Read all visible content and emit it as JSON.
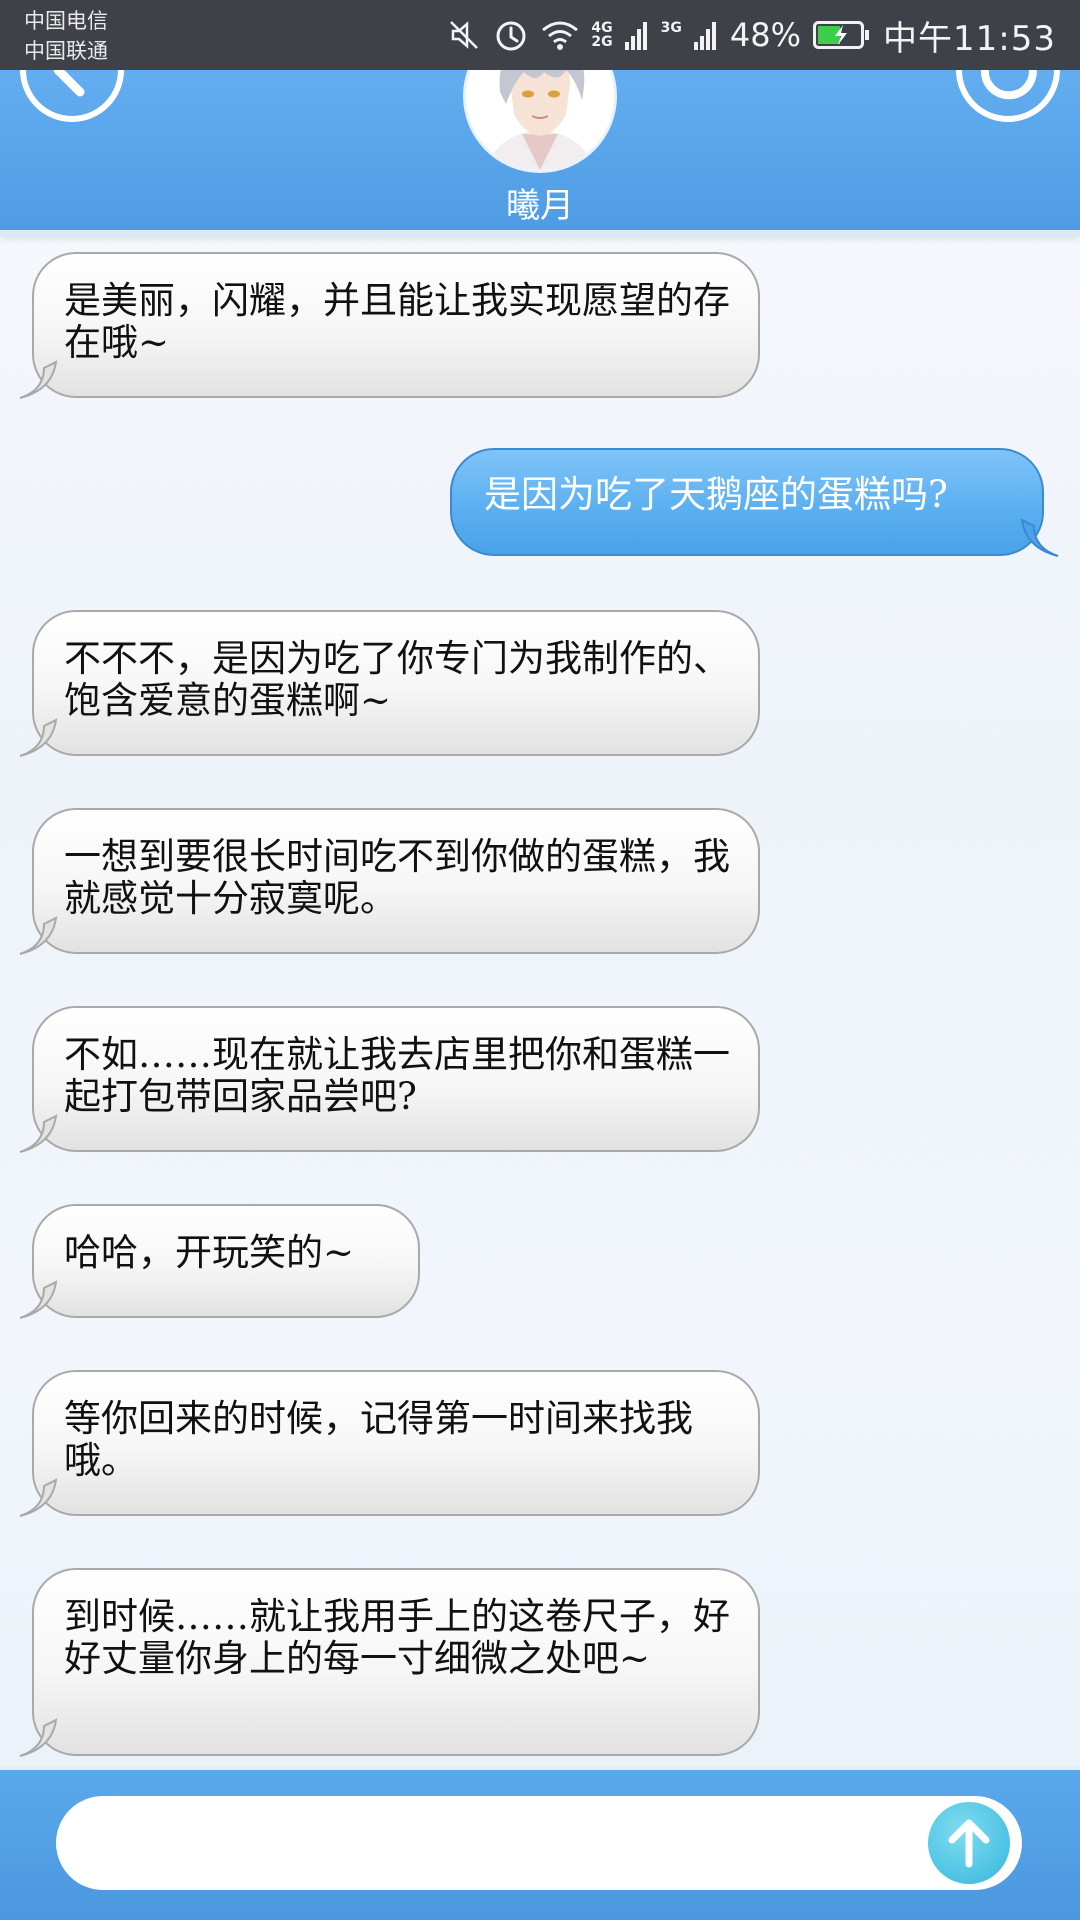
{
  "status_bar": {
    "carrier_1": "中国电信",
    "carrier_2": "中国联通",
    "net_1_top": "4G",
    "net_1_bottom": "2G",
    "net_2": "3G",
    "battery": "48%",
    "time": "中午11:53",
    "icons": [
      "mute-icon",
      "alarm-icon",
      "wifi-icon",
      "signal-icon",
      "battery-charging-icon"
    ]
  },
  "header": {
    "contact_name": "曦月",
    "back_icon": "chevron-left-icon",
    "refresh_icon": "refresh-icon"
  },
  "messages": [
    {
      "side": "left",
      "text": "是美丽，闪耀，并且能让我实现愿望的存在哦~"
    },
    {
      "side": "right",
      "text": "是因为吃了天鹅座的蛋糕吗?"
    },
    {
      "side": "left",
      "text": "不不不，是因为吃了你专门为我制作的、饱含爱意的蛋糕啊~"
    },
    {
      "side": "left",
      "text": "一想到要很长时间吃不到你做的蛋糕，我就感觉十分寂寞呢。"
    },
    {
      "side": "left",
      "text": "不如……现在就让我去店里把你和蛋糕一起打包带回家品尝吧?"
    },
    {
      "side": "left",
      "text": "哈哈，开玩笑的~"
    },
    {
      "side": "left",
      "text": "等你回来的时候，记得第一时间来找我哦。"
    },
    {
      "side": "left",
      "text": "到时候……就让我用手上的这卷尺子，好好丈量你身上的每一寸细微之处吧~"
    }
  ],
  "input": {
    "value": "",
    "send_icon": "arrow-up-icon"
  },
  "colors": {
    "header_blue": "#5aa6ec",
    "sent_bubble": "#5cb0f1",
    "received_bubble": "#f4f4f4",
    "send_button": "#4cc2e3"
  }
}
